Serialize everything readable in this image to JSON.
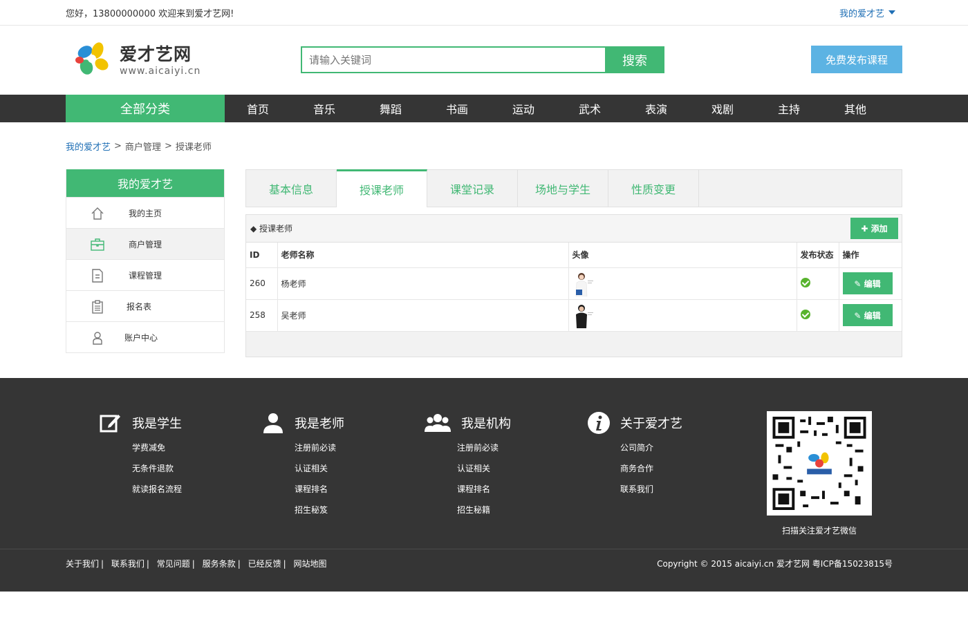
{
  "topbar": {
    "greeting": "您好，13800000000 欢迎来到爱才艺网!",
    "my_account": "我的爱才艺"
  },
  "header": {
    "logo_name": "爱才艺网",
    "logo_url": "www.aicaiyi.cn",
    "search_placeholder": "请输入关键词",
    "search_button": "搜索",
    "publish_button": "免费发布课程"
  },
  "nav": {
    "all_categories": "全部分类",
    "items": [
      "首页",
      "音乐",
      "舞蹈",
      "书画",
      "运动",
      "武术",
      "表演",
      "戏剧",
      "主持",
      "其他"
    ]
  },
  "breadcrumb": {
    "home": "我的爱才艺",
    "sep": ">",
    "level1": "商户管理",
    "level2": "授课老师"
  },
  "sidebar": {
    "title": "我的爱才艺",
    "items": [
      {
        "label": "我的主页",
        "icon": "home-icon"
      },
      {
        "label": "商户管理",
        "icon": "briefcase-icon"
      },
      {
        "label": "课程管理",
        "icon": "document-icon"
      },
      {
        "label": "报名表",
        "icon": "clipboard-icon"
      },
      {
        "label": "账户中心",
        "icon": "user-icon"
      }
    ]
  },
  "tabs": [
    "基本信息",
    "授课老师",
    "课堂记录",
    "场地与学生",
    "性质变更"
  ],
  "panel": {
    "title": "◆ 授课老师",
    "add_button": "✚ 添加",
    "columns": [
      "ID",
      "老师名称",
      "头像",
      "发布状态",
      "操作"
    ],
    "rows": [
      {
        "id": "260",
        "name": "杨老师",
        "edit": "✎ 编辑"
      },
      {
        "id": "258",
        "name": "吴老师",
        "edit": "✎ 编辑"
      }
    ]
  },
  "footer": {
    "cols": [
      {
        "title": "我是学生",
        "icon": "edit-icon",
        "links": [
          "学费减免",
          "无条件退款",
          "就读报名流程"
        ]
      },
      {
        "title": "我是老师",
        "icon": "teacher-icon",
        "links": [
          "注册前必读",
          "认证相关",
          "课程排名",
          "招生秘笈"
        ]
      },
      {
        "title": "我是机构",
        "icon": "group-icon",
        "links": [
          "注册前必读",
          "认证相关",
          "课程排名",
          "招生秘籍"
        ]
      },
      {
        "title": "关于爱才艺",
        "icon": "info-icon",
        "links": [
          "公司简介",
          "商务合作",
          "联系我们"
        ]
      }
    ],
    "qr_caption": "扫描关注爱才艺微信",
    "bottom_links": [
      "关于我们",
      "联系我们",
      "常见问题",
      "服务条款",
      "已经反馈",
      "网站地图"
    ],
    "copyright": "Copyright © 2015 aicaiyi.cn 爱才艺网 粤ICP备15023815号"
  }
}
